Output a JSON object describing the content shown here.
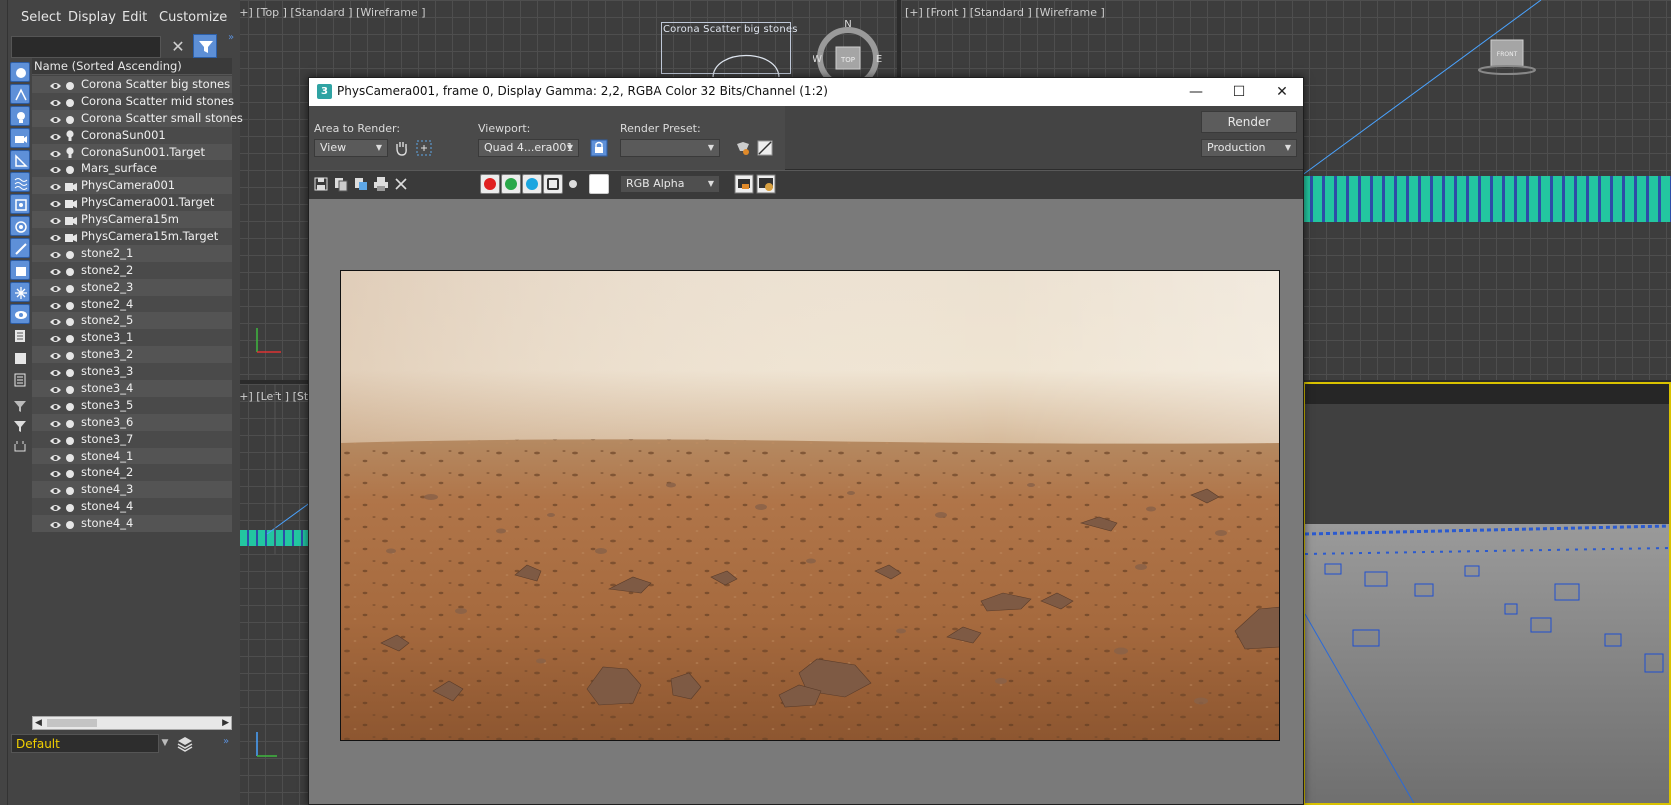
{
  "scene_explorer": {
    "menu": [
      "Select",
      "Display",
      "Edit",
      "Customize"
    ],
    "search": {
      "value": "",
      "placeholder": ""
    },
    "column_header": "Name (Sorted Ascending)",
    "items": [
      {
        "label": "Corona Scatter big stones",
        "type": "scatter"
      },
      {
        "label": "Corona Scatter mid stones",
        "type": "scatter"
      },
      {
        "label": "Corona Scatter small stones",
        "type": "scatter"
      },
      {
        "label": "CoronaSun001",
        "type": "light"
      },
      {
        "label": "CoronaSun001.Target",
        "type": "light"
      },
      {
        "label": "Mars_surface",
        "type": "geometry"
      },
      {
        "label": "PhysCamera001",
        "type": "camera"
      },
      {
        "label": "PhysCamera001.Target",
        "type": "camera"
      },
      {
        "label": "PhysCamera15m",
        "type": "camera"
      },
      {
        "label": "PhysCamera15m.Target",
        "type": "camera"
      },
      {
        "label": "stone2_1",
        "type": "geometry"
      },
      {
        "label": "stone2_2",
        "type": "geometry"
      },
      {
        "label": "stone2_3",
        "type": "geometry"
      },
      {
        "label": "stone2_4",
        "type": "geometry"
      },
      {
        "label": "stone2_5",
        "type": "geometry"
      },
      {
        "label": "stone3_1",
        "type": "geometry"
      },
      {
        "label": "stone3_2",
        "type": "geometry"
      },
      {
        "label": "stone3_3",
        "type": "geometry"
      },
      {
        "label": "stone3_4",
        "type": "geometry"
      },
      {
        "label": "stone3_5",
        "type": "geometry"
      },
      {
        "label": "stone3_6",
        "type": "geometry"
      },
      {
        "label": "stone3_7",
        "type": "geometry"
      },
      {
        "label": "stone4_1",
        "type": "geometry"
      },
      {
        "label": "stone4_2",
        "type": "geometry"
      },
      {
        "label": "stone4_3",
        "type": "geometry"
      },
      {
        "label": "stone4_4",
        "type": "geometry"
      },
      {
        "label": "stone4_4",
        "type": "geometry"
      }
    ],
    "layer": "Default"
  },
  "viewports": {
    "top": "[+] [Top ] [Standard ] [Wireframe ]",
    "front": "[+] [Front ] [Standard ] [Wireframe ]",
    "left": "[+] [Left ] [Sta",
    "top_object_label": "Corona Scatter big stones",
    "viewcube_top": {
      "face": "TOP",
      "n": "N",
      "w": "W",
      "e": "E"
    },
    "viewcube_front": "FRONT"
  },
  "frame_buffer": {
    "app_icon": "3",
    "title": "PhysCamera001, frame 0, Display Gamma: 2,2, RGBA Color 32 Bits/Channel (1:2)",
    "window_controls": {
      "minimize": "—",
      "maximize": "☐",
      "close": "✕"
    },
    "area_to_render": {
      "label": "Area to Render:",
      "value": "View"
    },
    "viewport": {
      "label": "Viewport:",
      "value": "Quad 4...era001"
    },
    "render_preset": {
      "label": "Render Preset:",
      "value": ""
    },
    "render_button": "Render",
    "production": "Production",
    "channel": "RGB Alpha",
    "channel_colors": {
      "red": "#e02020",
      "green": "#2aa84a",
      "blue": "#1aa6e0"
    }
  },
  "colors": {
    "ui_bg": "#444444",
    "accent_blue": "#5e90d8",
    "layer_yellow": "#f2d000",
    "terrain_teal": "#23c6a0"
  }
}
